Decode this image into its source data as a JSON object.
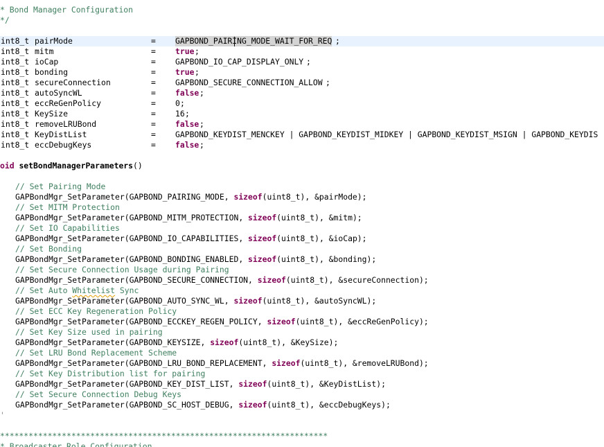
{
  "editor": {
    "header_comment": {
      "line1": "* Bond Manager Configuration",
      "line2": "*/"
    },
    "decls": [
      {
        "type": "int8_t",
        "name": "pairMode",
        "eq": "=",
        "value": "GAPBOND_PAIRING_MODE_WAIT_FOR_REQ",
        "semi": ";",
        "kind": "const"
      },
      {
        "type": "int8_t",
        "name": "mitm",
        "eq": "=",
        "value": "true",
        "semi": ";",
        "kind": "keyword"
      },
      {
        "type": "int8_t",
        "name": "ioCap",
        "eq": "=",
        "value": "GAPBOND_IO_CAP_DISPLAY_ONLY",
        "semi": ";",
        "kind": "const"
      },
      {
        "type": "int8_t",
        "name": "bonding",
        "eq": "=",
        "value": "true",
        "semi": ";",
        "kind": "keyword"
      },
      {
        "type": "int8_t",
        "name": "secureConnection",
        "eq": "=",
        "value": "GAPBOND_SECURE_CONNECTION_ALLOW",
        "semi": ";",
        "kind": "const"
      },
      {
        "type": "int8_t",
        "name": "autoSyncWL",
        "eq": "=",
        "value": "false",
        "semi": ";",
        "kind": "keyword"
      },
      {
        "type": "int8_t",
        "name": "eccReGenPolicy",
        "eq": "=",
        "value": "0",
        "semi": ";",
        "kind": "number"
      },
      {
        "type": "int8_t",
        "name": "KeySize",
        "eq": "=",
        "value": "16",
        "semi": ";",
        "kind": "number"
      },
      {
        "type": "int8_t",
        "name": "removeLRUBond",
        "eq": "=",
        "value": "false",
        "semi": ";",
        "kind": "keyword"
      },
      {
        "type": "int8_t",
        "name": "KeyDistList",
        "eq": "=",
        "value": "GAPBOND_KEYDIST_MENCKEY | GAPBOND_KEYDIST_MIDKEY | GAPBOND_KEYDIST_MSIGN | GAPBOND_KEYDIS",
        "semi": "",
        "kind": "const"
      },
      {
        "type": "int8_t",
        "name": "eccDebugKeys",
        "eq": "=",
        "value": "false",
        "semi": ";",
        "kind": "keyword"
      }
    ],
    "func_decl": {
      "prefix": "oid",
      "name": "setBondManagerParameters",
      "suffix": "()"
    },
    "calls": [
      {
        "comment": "// Set Pairing Mode",
        "fn": "GAPBondMgr_SetParameter(",
        "param": "GAPBOND_PAIRING_MODE, ",
        "kw": "sizeof",
        "type_arg": "(uint8_t)",
        "arg": ", &pairMode);"
      },
      {
        "comment": "// Set MITM Protection",
        "fn": "GAPBondMgr_SetParameter(",
        "param": "GAPBOND_MITM_PROTECTION, ",
        "kw": "sizeof",
        "type_arg": "(uint8_t)",
        "arg": ", &mitm);"
      },
      {
        "comment": "// Set IO Capabilities",
        "fn": "GAPBondMgr_SetParameter(",
        "param": "GAPBOND_IO_CAPABILITIES, ",
        "kw": "sizeof",
        "type_arg": "(uint8_t)",
        "arg": ", &ioCap);"
      },
      {
        "comment": "// Set Bonding",
        "fn": "GAPBondMgr_SetParameter(",
        "param": "GAPBOND_BONDING_ENABLED, ",
        "kw": "sizeof",
        "type_arg": "(uint8_t)",
        "arg": ", &bonding);"
      },
      {
        "comment": "// Set Secure Connection Usage during Pairing",
        "fn": "GAPBondMgr_SetParameter(",
        "param": "GAPBOND_SECURE_CONNECTION, ",
        "kw": "sizeof",
        "type_arg": "(uint8_t)",
        "arg": ", &secureConnection);"
      },
      {
        "comment_pre": "// Set Auto ",
        "comment_spell": "Whitelist",
        "comment_post": " Sync",
        "fn": "GAPBondMgr_SetParameter(",
        "param": "GAPBOND_AUTO_SYNC_WL, ",
        "kw": "sizeof",
        "type_arg": "(uint8_t)",
        "arg": ", &autoSyncWL);"
      },
      {
        "comment": "// Set ECC Key Regeneration Policy",
        "fn": "GAPBondMgr_SetParameter(",
        "param": "GAPBOND_ECCKEY_REGEN_POLICY, ",
        "kw": "sizeof",
        "type_arg": "(uint8_t)",
        "arg": ", &eccReGenPolicy);"
      },
      {
        "comment": "// Set Key Size used in pairing",
        "fn": "GAPBondMgr_SetParameter(",
        "param": "GAPBOND_KEYSIZE, ",
        "kw": "sizeof",
        "type_arg": "(uint8_t)",
        "arg": ", &KeySize);"
      },
      {
        "comment": "// Set LRU Bond Replacement Scheme",
        "fn": "GAPBondMgr_SetParameter(",
        "param": "GAPBOND_LRU_BOND_REPLACEMENT, ",
        "kw": "sizeof",
        "type_arg": "(uint8_t)",
        "arg": ", &removeLRUBond);"
      },
      {
        "comment": "// Set Key Distribution list for pairing",
        "fn": "GAPBondMgr_SetParameter(",
        "param": "GAPBOND_KEY_DIST_LIST, ",
        "kw": "sizeof",
        "type_arg": "(uint8_t)",
        "arg": ", &KeyDistList);"
      },
      {
        "comment": "// Set Secure Connection Debug Keys",
        "fn": "GAPBondMgr_SetParameter(",
        "param": "GAPBOND_SC_HOST_DEBUG, ",
        "kw": "sizeof",
        "type_arg": "(uint8_t)",
        "arg": ", &eccDebugKeys);"
      }
    ],
    "closing_mark": "'",
    "divider_comment": "*********************************************************************",
    "next_section_comment": "* Broadcaster Role Configuration",
    "colors": {
      "comment": "#3f7f5f",
      "keyword": "#7f0055",
      "current_line": "#e8f2fe",
      "occurrence_highlight": "#d4d4d4"
    }
  }
}
